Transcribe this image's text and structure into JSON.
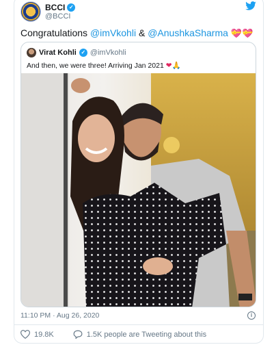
{
  "tweet": {
    "author_name": "BCCI",
    "author_handle": "@BCCI",
    "text_prefix": "Congratulations ",
    "mention_1": "@imVkohli",
    "text_mid": " & ",
    "mention_2": "@AnushkaSharma",
    "emojis": "💝💝",
    "timestamp": "11:10 PM · Aug 26, 2020"
  },
  "quoted": {
    "author_name": "Virat Kohli",
    "author_handle": "@imVkohli",
    "text": "And then, we were three! Arriving Jan 2021 ",
    "emojis": "❤🙏"
  },
  "actions": {
    "likes": "19.8K",
    "retweet_text": "1.5K people are Tweeting about this"
  },
  "colors": {
    "link": "#1b95e0",
    "verified": "#1da1f2",
    "muted": "#657786"
  },
  "icons": [
    "twitter-bird-icon",
    "verified-icon",
    "info-icon",
    "heart-icon",
    "comment-icon"
  ]
}
